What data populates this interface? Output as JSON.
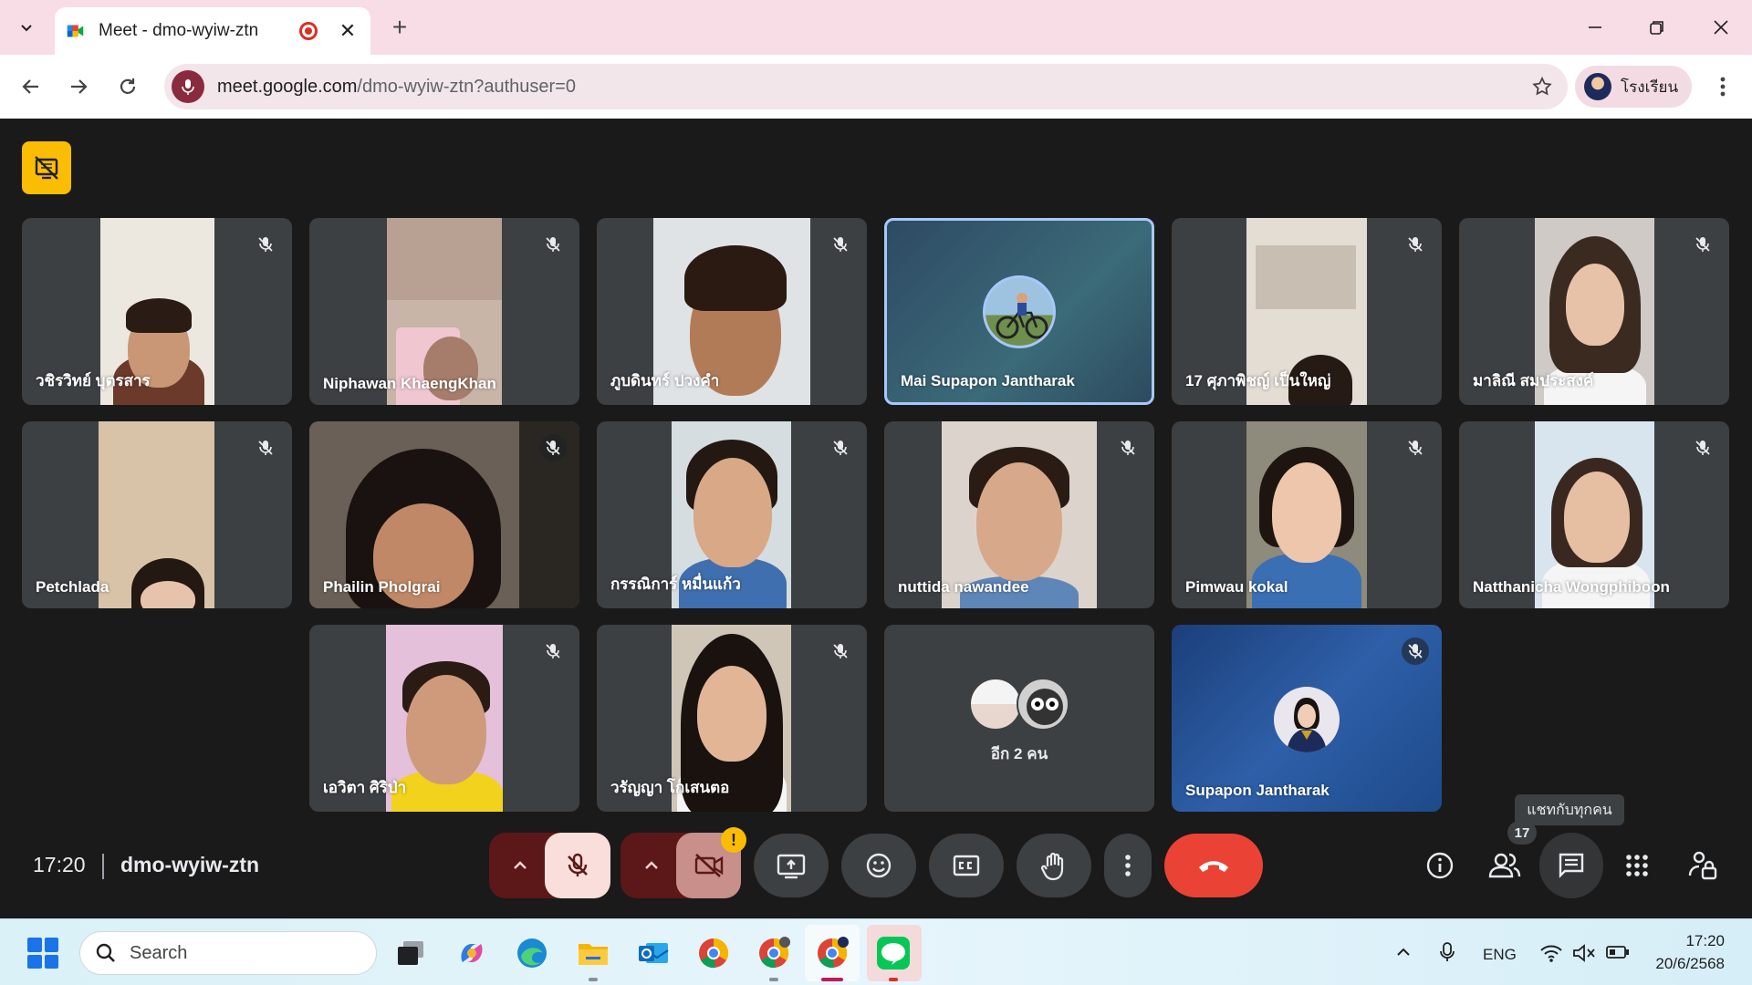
{
  "browser": {
    "tab_title": "Meet - dmo-wyiw-ztn",
    "url_main": "meet.google.com",
    "url_path": "/dmo-wyiw-ztn?authuser=0",
    "profile_name": "โรงเรียน"
  },
  "participants": [
    {
      "name": "วชิรวิทย์ บุตรสาร",
      "muted": true
    },
    {
      "name": "Niphawan KhaengKhan",
      "muted": true
    },
    {
      "name": "ภูบดินทร์ ปวงคำ",
      "muted": true
    },
    {
      "name": "Mai Supapon Jantharak",
      "muted": false,
      "speaking": true
    },
    {
      "name": "17 ศุภาพิชญ์ เป็นใหญ่",
      "muted": true
    },
    {
      "name": "มาลิณี สมประสงค์",
      "muted": true
    },
    {
      "name": "Petchlada",
      "muted": true
    },
    {
      "name": "Phailin Pholgrai",
      "muted": true
    },
    {
      "name": "กรรณิการ์ หมื่นแก้ว",
      "muted": true
    },
    {
      "name": "nuttida nawandee",
      "muted": true
    },
    {
      "name": "Pimwau kokal",
      "muted": true
    },
    {
      "name": "Natthanicha Wongphiboon",
      "muted": true
    },
    {
      "name": "เอวิตา ศิริป่า",
      "muted": true
    },
    {
      "name": "วรัญญา โกเสนตอ",
      "muted": true
    },
    {
      "name": "อีก 2 คน",
      "muted": false
    },
    {
      "name": "Supapon Jantharak",
      "muted": true
    }
  ],
  "tooltip_chat": "แชทกับทุกคน",
  "controls": {
    "time": "17:20",
    "meeting_code": "dmo-wyiw-ztn",
    "people_count": "17",
    "warning_badge": "!"
  },
  "taskbar": {
    "search_label": "Search",
    "language": "ENG",
    "time": "17:20",
    "date": "20/6/2568"
  },
  "colors": {
    "end_call": "#ea4335",
    "muted_control": "#5c1818",
    "tab_strip": "#f9dde6",
    "highlight_border": "#a8c7fa",
    "notice": "#fbbc04"
  }
}
